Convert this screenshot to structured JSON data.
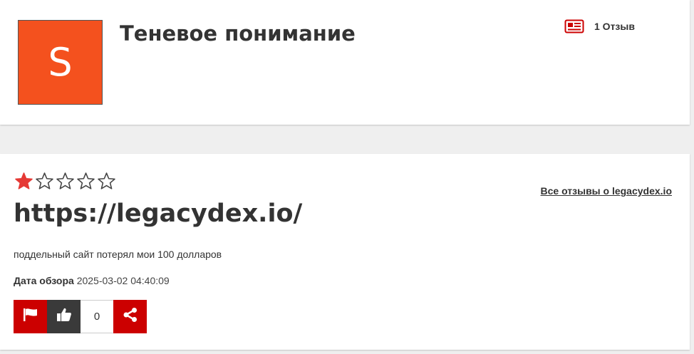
{
  "profile": {
    "avatar_letter": "S",
    "avatar_color": "#f4511e",
    "name": "Теневое понимание",
    "review_count": "1 Отзыв",
    "review_icon": "newspaper-icon"
  },
  "review": {
    "rating": 1,
    "rating_max": 5,
    "star_color": "#e53935",
    "site_url": "https://legacydex.io/",
    "all_reviews_link": "Все отзывы о legacydex.io",
    "text": "поддельный сайт потерял мои 100 долларов",
    "date_label": "Дата обзора",
    "date_value": "2025-03-02 04:40:09",
    "likes": "0",
    "actions": {
      "flag_icon": "flag-icon",
      "like_icon": "thumbs-up-icon",
      "share_icon": "share-icon"
    }
  },
  "colors": {
    "accent": "#cc0000",
    "dark_button": "#3a3a3a",
    "background": "#efefef"
  }
}
